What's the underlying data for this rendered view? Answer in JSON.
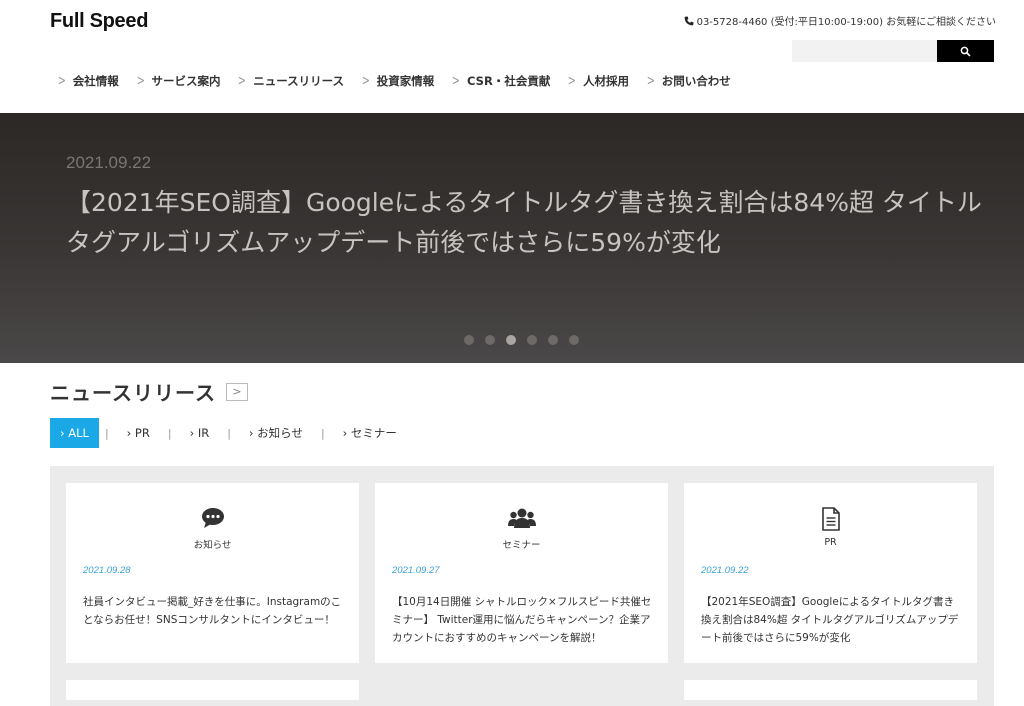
{
  "header": {
    "logo": "Full Speed",
    "contact": "03-5728-4460 (受付:平日10:00-19:00) お気軽にご相談ください",
    "search_placeholder": ""
  },
  "nav": [
    {
      "label": "会社情報"
    },
    {
      "label": "サービス案内"
    },
    {
      "label": "ニュースリリース"
    },
    {
      "label": "投資家情報"
    },
    {
      "label": "CSR・社会貢献"
    },
    {
      "label": "人材採用"
    },
    {
      "label": "お問い合わせ"
    }
  ],
  "hero": {
    "date": "2021.09.22",
    "title": "【2021年SEO調査】Googleによるタイトルタグ書き換え割合は84%超 タイトルタグアルゴリズムアップデート前後ではさらに59%が変化",
    "slide_count": 6,
    "active_slide": 3
  },
  "news": {
    "title": "ニュースリリース",
    "arrow": ">",
    "filters": [
      {
        "label": "› ALL",
        "active": true
      },
      {
        "label": "› PR"
      },
      {
        "label": "› IR"
      },
      {
        "label": "› お知らせ"
      },
      {
        "label": "› セミナー"
      }
    ],
    "cards": [
      {
        "icon": "comment-icon",
        "category": "お知らせ",
        "date": "2021.09.28",
        "text": "社員インタビュー掲載_好きを仕事に。Instagramのことならお任せ！SNSコンサルタントにインタビュー！"
      },
      {
        "icon": "users-icon",
        "category": "セミナー",
        "date": "2021.09.27",
        "text": "【10月14日開催 シャトルロック×フルスピード共催セミナー】 Twitter運用に悩んだらキャンペーン？企業アカウントにおすすめのキャンペーンを解説！"
      },
      {
        "icon": "document-icon",
        "category": "PR",
        "date": "2021.09.22",
        "text": "【2021年SEO調査】Googleによるタイトルタグ書き換え割合は84%超 タイトルタグアルゴリズムアップデート前後ではさらに59%が変化"
      }
    ]
  },
  "colors": {
    "accent": "#1aa9e6",
    "date_blue": "#3ba3d6",
    "hero_bg": "#3a3635"
  }
}
